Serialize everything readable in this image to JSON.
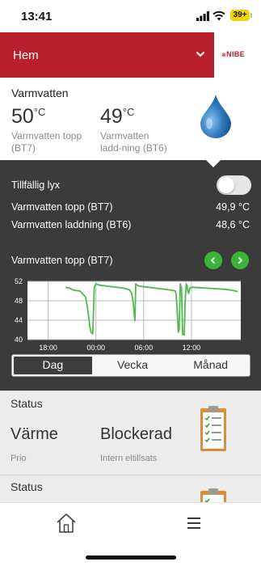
{
  "statusbar": {
    "time": "13:41",
    "battery": "39+"
  },
  "header": {
    "menu_label": "Hem",
    "logo_text": "NIBE",
    "brand_color": "#b7202c"
  },
  "hotwater": {
    "title": "Varmvatten",
    "top_value": "50",
    "top_unit": "°C",
    "top_label": "Varmvatten topp (BT7)",
    "charge_value": "49",
    "charge_unit": "°C",
    "charge_label": "Varmvatten ladd-ning (BT6)"
  },
  "details": {
    "temp_lux_label": "Tillfällig lyx",
    "temp_lux_on": false,
    "rows": [
      {
        "label": "Varmvatten topp (BT7)",
        "value": "49,9 °C"
      },
      {
        "label": "Varmvatten laddning (BT6)",
        "value": "48,6 °C"
      }
    ],
    "chart_title": "Varmvatten topp (BT7)",
    "segments": [
      "Dag",
      "Vecka",
      "Månad"
    ],
    "active_segment": "Dag"
  },
  "chart_data": {
    "type": "line",
    "title": "Varmvatten topp (BT7)",
    "ylim": [
      40,
      52
    ],
    "yticks": [
      "52",
      "48",
      "44",
      "40"
    ],
    "xticks": [
      "18:00",
      "00:00",
      "06:00",
      "12:00"
    ],
    "series": [
      {
        "color": "#4fb84f",
        "x": [
          -3.8,
          -3.3,
          -2.8,
          -2.0,
          -1.3,
          -1.1,
          -0.9,
          -0.75,
          -0.6,
          -0.4,
          -0.2,
          0.0,
          0.5,
          1.5,
          2.5,
          3.5,
          4.2,
          4.5,
          4.7,
          4.8,
          4.9,
          5.0,
          5.2,
          5.5,
          6.5,
          7.5,
          8.5,
          9.5,
          10.0,
          10.1,
          10.2,
          10.35,
          10.45,
          10.6,
          10.75,
          10.9,
          11.1,
          11.2,
          11.35,
          11.45,
          11.55,
          11.65,
          11.8,
          12.0,
          13.0,
          14.0,
          15.0,
          16.0,
          17.0,
          17.8
        ],
        "y": [
          50.8,
          50.6,
          50.2,
          50.0,
          48.8,
          47.0,
          44.5,
          42.5,
          41.5,
          41.2,
          50.8,
          51.5,
          51.2,
          51.0,
          50.8,
          50.6,
          50.3,
          49.5,
          47.5,
          45.5,
          43.9,
          51.5,
          51.2,
          51.0,
          50.8,
          50.6,
          50.4,
          50.2,
          50.0,
          49.0,
          46.0,
          41.5,
          42.0,
          51.5,
          50.6,
          41.0,
          41.0,
          47.5,
          51.5,
          51.0,
          50.0,
          49.5,
          50.6,
          50.8,
          50.7,
          50.6,
          50.5,
          50.4,
          50.2,
          49.9
        ]
      }
    ]
  },
  "status_cards": [
    {
      "title": "Status",
      "value1": "Värme",
      "label1": "Prio",
      "value2": "Blockerad",
      "label2": "Intern eltillsats"
    },
    {
      "title": "Status"
    }
  ],
  "icons": {
    "droplet": "droplet-icon",
    "clipboard": "clipboard-icon",
    "home": "home-icon",
    "menu": "hamburger-menu-icon"
  }
}
